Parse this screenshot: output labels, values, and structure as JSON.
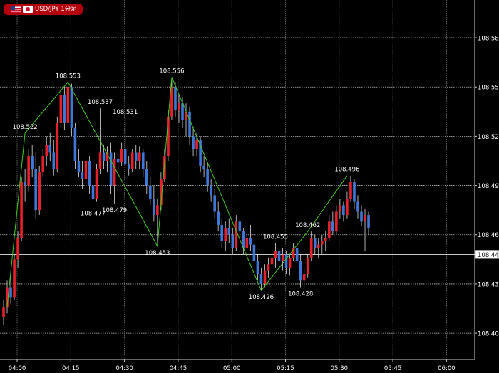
{
  "header": {
    "pair_label": "USD/JPY 1分足"
  },
  "colors": {
    "background": "#000000",
    "grid": "#bdbdbd",
    "bull": "#e8202a",
    "bear": "#3d78d8",
    "wick": "#dddddd",
    "zigzag": "#3fcf1a",
    "text": "#ffffff",
    "price_line": "#e6e6e6"
  },
  "chart_data": {
    "type": "candlestick",
    "y_range": [
      108.384,
      108.603
    ],
    "y_ticks": [
      {
        "value": 108.58,
        "label": "108.580"
      },
      {
        "value": 108.55,
        "label": "108.550"
      },
      {
        "value": 108.52,
        "label": "108.520"
      },
      {
        "value": 108.49,
        "label": "108.490"
      },
      {
        "value": 108.46,
        "label": "108.460"
      },
      {
        "value": 108.43,
        "label": "108.430"
      },
      {
        "value": 108.4,
        "label": "108.400"
      }
    ],
    "x_ticks": [
      {
        "index": 0,
        "label": "04:00"
      },
      {
        "index": 15,
        "label": "04:15"
      },
      {
        "index": 30,
        "label": "04:30"
      },
      {
        "index": 45,
        "label": "04:45"
      },
      {
        "index": 60,
        "label": "05:00"
      },
      {
        "index": 75,
        "label": "05:15"
      },
      {
        "index": 90,
        "label": "05:30"
      },
      {
        "index": 105,
        "label": "05:45"
      },
      {
        "index": 120,
        "label": "06:00"
      }
    ],
    "current_price": {
      "value": 108.448,
      "label": "108.448"
    },
    "candles": [
      [
        108.41,
        108.42,
        108.405,
        108.416
      ],
      [
        108.416,
        108.432,
        108.412,
        108.428
      ],
      [
        108.428,
        108.436,
        108.418,
        108.422
      ],
      [
        108.422,
        108.448,
        108.42,
        108.445
      ],
      [
        108.445,
        108.462,
        108.44,
        108.458
      ],
      [
        108.458,
        108.495,
        108.456,
        108.492
      ],
      [
        108.492,
        108.5,
        108.48,
        108.49
      ],
      [
        108.49,
        108.512,
        108.486,
        108.508
      ],
      [
        108.508,
        108.515,
        108.495,
        108.5
      ],
      [
        108.5,
        108.51,
        108.47,
        108.475
      ],
      [
        108.475,
        108.502,
        108.472,
        108.498
      ],
      [
        108.498,
        108.512,
        108.495,
        108.508
      ],
      [
        108.508,
        108.52,
        108.502,
        108.515
      ],
      [
        108.515,
        108.522,
        108.505,
        108.51
      ],
      [
        108.51,
        108.518,
        108.496,
        108.5
      ],
      [
        108.5,
        108.532,
        108.498,
        108.528
      ],
      [
        108.528,
        108.547,
        108.525,
        108.545
      ],
      [
        108.545,
        108.55,
        108.524,
        108.528
      ],
      [
        108.528,
        108.553,
        108.526,
        108.55
      ],
      [
        108.55,
        108.552,
        108.52,
        108.525
      ],
      [
        108.525,
        108.528,
        108.5,
        108.505
      ],
      [
        108.505,
        108.512,
        108.495,
        108.498
      ],
      [
        108.498,
        108.505,
        108.488,
        108.494
      ],
      [
        108.494,
        108.51,
        108.492,
        108.505
      ],
      [
        108.505,
        108.508,
        108.485,
        108.49
      ],
      [
        108.49,
        108.5,
        108.477,
        108.482
      ],
      [
        108.482,
        108.503,
        108.48,
        108.5
      ],
      [
        108.5,
        108.537,
        108.497,
        108.51
      ],
      [
        108.51,
        108.515,
        108.5,
        108.505
      ],
      [
        108.505,
        108.514,
        108.498,
        108.51
      ],
      [
        108.51,
        108.516,
        108.485,
        108.49
      ],
      [
        108.49,
        108.51,
        108.479,
        108.506
      ],
      [
        108.506,
        108.512,
        108.5,
        108.504
      ],
      [
        108.504,
        108.516,
        108.502,
        108.512
      ],
      [
        108.512,
        108.531,
        108.5,
        108.503
      ],
      [
        108.503,
        108.508,
        108.496,
        108.5
      ],
      [
        108.5,
        108.512,
        108.498,
        108.51
      ],
      [
        108.51,
        108.515,
        108.5,
        108.505
      ],
      [
        108.505,
        108.514,
        108.5,
        108.51
      ],
      [
        108.51,
        108.512,
        108.495,
        108.5
      ],
      [
        108.5,
        108.505,
        108.485,
        108.49
      ],
      [
        108.49,
        108.495,
        108.478,
        108.482
      ],
      [
        108.482,
        108.49,
        108.468,
        108.472
      ],
      [
        108.472,
        108.482,
        108.453,
        108.478
      ],
      [
        108.478,
        108.498,
        108.475,
        108.494
      ],
      [
        108.494,
        108.512,
        108.492,
        108.508
      ],
      [
        108.508,
        108.536,
        108.505,
        108.532
      ],
      [
        108.532,
        108.556,
        108.53,
        108.55
      ],
      [
        108.55,
        108.553,
        108.532,
        108.536
      ],
      [
        108.536,
        108.545,
        108.528,
        108.54
      ],
      [
        108.54,
        108.544,
        108.525,
        108.53
      ],
      [
        108.53,
        108.54,
        108.52,
        108.535
      ],
      [
        108.535,
        108.538,
        108.515,
        108.52
      ],
      [
        108.52,
        108.526,
        108.508,
        108.512
      ],
      [
        108.512,
        108.522,
        108.508,
        108.518
      ],
      [
        108.518,
        108.52,
        108.498,
        108.502
      ],
      [
        108.502,
        108.508,
        108.495,
        108.5
      ],
      [
        108.5,
        108.504,
        108.486,
        108.49
      ],
      [
        108.49,
        108.494,
        108.48,
        108.484
      ],
      [
        108.484,
        108.488,
        108.47,
        108.474
      ],
      [
        108.474,
        108.48,
        108.462,
        108.466
      ],
      [
        108.466,
        108.47,
        108.452,
        108.456
      ],
      [
        108.456,
        108.468,
        108.45,
        108.464
      ],
      [
        108.464,
        108.47,
        108.455,
        108.46
      ],
      [
        108.46,
        108.464,
        108.448,
        108.452
      ],
      [
        108.452,
        108.472,
        108.45,
        108.468
      ],
      [
        108.468,
        108.47,
        108.458,
        108.462
      ],
      [
        108.462,
        108.464,
        108.448,
        108.452
      ],
      [
        108.452,
        108.46,
        108.446,
        108.458
      ],
      [
        108.458,
        108.466,
        108.45,
        108.454
      ],
      [
        108.454,
        108.456,
        108.44,
        108.444
      ],
      [
        108.444,
        108.448,
        108.432,
        108.436
      ],
      [
        108.436,
        108.44,
        108.426,
        108.43
      ],
      [
        108.43,
        108.442,
        108.428,
        108.438
      ],
      [
        108.438,
        108.446,
        108.434,
        108.442
      ],
      [
        108.442,
        108.45,
        108.436,
        108.446
      ],
      [
        108.446,
        108.455,
        108.44,
        108.45
      ],
      [
        108.45,
        108.454,
        108.44,
        108.444
      ],
      [
        108.444,
        108.452,
        108.438,
        108.448
      ],
      [
        108.448,
        108.45,
        108.436,
        108.44
      ],
      [
        108.44,
        108.448,
        108.435,
        108.446
      ],
      [
        108.446,
        108.455,
        108.444,
        108.452
      ],
      [
        108.452,
        108.454,
        108.44,
        108.444
      ],
      [
        108.444,
        108.448,
        108.428,
        108.432
      ],
      [
        108.432,
        108.44,
        108.428,
        108.436
      ],
      [
        108.436,
        108.448,
        108.434,
        108.446
      ],
      [
        108.446,
        108.462,
        108.444,
        108.458
      ],
      [
        108.458,
        108.46,
        108.448,
        108.452
      ],
      [
        108.452,
        108.458,
        108.446,
        108.454
      ],
      [
        108.454,
        108.46,
        108.448,
        108.456
      ],
      [
        108.456,
        108.462,
        108.45,
        108.458
      ],
      [
        108.458,
        108.472,
        108.456,
        108.468
      ],
      [
        108.468,
        108.474,
        108.46,
        108.462
      ],
      [
        108.462,
        108.478,
        108.46,
        108.474
      ],
      [
        108.474,
        108.482,
        108.47,
        108.478
      ],
      [
        108.478,
        108.48,
        108.468,
        108.472
      ],
      [
        108.472,
        108.486,
        108.47,
        108.482
      ],
      [
        108.482,
        108.496,
        108.48,
        108.492
      ],
      [
        108.492,
        108.494,
        108.476,
        108.48
      ],
      [
        108.48,
        108.484,
        108.47,
        108.474
      ],
      [
        108.474,
        108.478,
        108.465,
        108.468
      ],
      [
        108.468,
        108.476,
        108.45,
        108.472
      ],
      [
        108.472,
        108.474,
        108.46,
        108.464
      ]
    ],
    "zigzag": [
      {
        "index": 1,
        "value": 108.416
      },
      {
        "index": 6,
        "value": 108.522
      },
      {
        "index": 18,
        "value": 108.553
      },
      {
        "index": 43,
        "value": 108.453
      },
      {
        "index": 47,
        "value": 108.556
      },
      {
        "index": 72,
        "value": 108.426
      },
      {
        "index": 85,
        "value": 108.462
      },
      {
        "index": 96,
        "value": 108.496
      }
    ],
    "annotations": [
      {
        "index": 6,
        "value": 108.522,
        "label": "108.522",
        "pos": "above"
      },
      {
        "index": 18,
        "value": 108.553,
        "label": "108.553",
        "pos": "above"
      },
      {
        "index": 27,
        "value": 108.537,
        "label": "108.537",
        "pos": "above"
      },
      {
        "index": 34,
        "value": 108.531,
        "label": "108.531",
        "pos": "above"
      },
      {
        "index": 25,
        "value": 108.477,
        "label": "108.477",
        "pos": "below"
      },
      {
        "index": 31,
        "value": 108.479,
        "label": "108.479",
        "pos": "below"
      },
      {
        "index": 43,
        "value": 108.453,
        "label": "108.453",
        "pos": "below"
      },
      {
        "index": 47,
        "value": 108.556,
        "label": "108.556",
        "pos": "above"
      },
      {
        "index": 72,
        "value": 108.426,
        "label": "108.426",
        "pos": "below"
      },
      {
        "index": 76,
        "value": 108.455,
        "label": "108.455",
        "pos": "above"
      },
      {
        "index": 83,
        "value": 108.428,
        "label": "108.428",
        "pos": "below"
      },
      {
        "index": 85,
        "value": 108.462,
        "label": "108.462",
        "pos": "above"
      },
      {
        "index": 96,
        "value": 108.496,
        "label": "108.496",
        "pos": "above"
      }
    ]
  }
}
